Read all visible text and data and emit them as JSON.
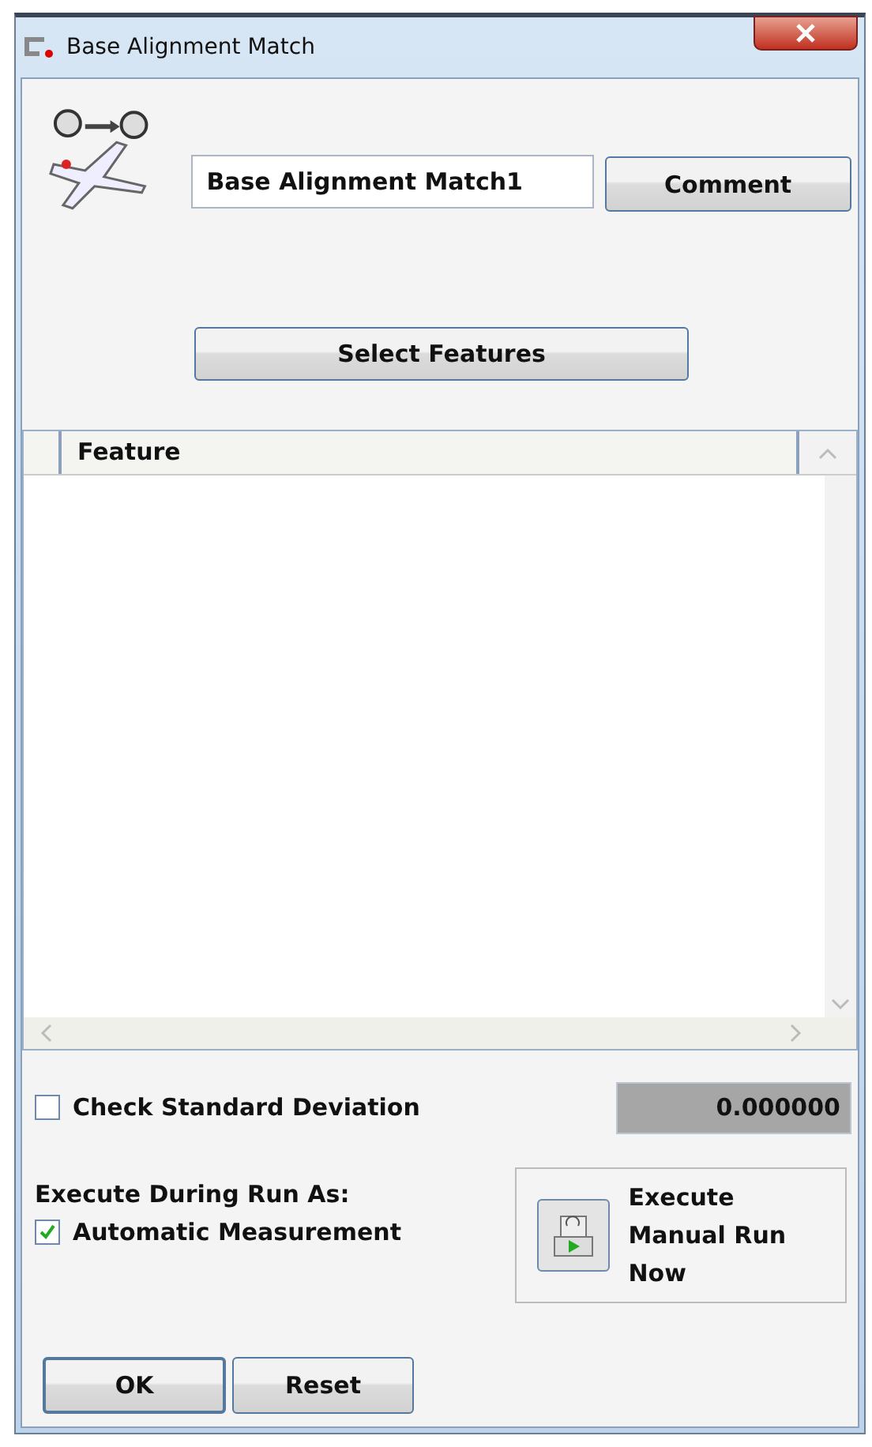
{
  "window": {
    "title": "Base Alignment Match"
  },
  "name_field": {
    "value": "Base Alignment Match1"
  },
  "buttons": {
    "comment": "Comment",
    "select_features": "Select Features",
    "ok": "OK",
    "reset": "Reset"
  },
  "table": {
    "columns": [
      "Feature"
    ]
  },
  "check_standard_deviation": {
    "label": "Check Standard Deviation",
    "checked": false,
    "value": "0.000000"
  },
  "execute_during_run": {
    "label": "Execute During Run As:",
    "option": {
      "label": "Automatic Measurement",
      "checked": true
    }
  },
  "manual_run": {
    "label": "Execute Manual Run Now"
  }
}
